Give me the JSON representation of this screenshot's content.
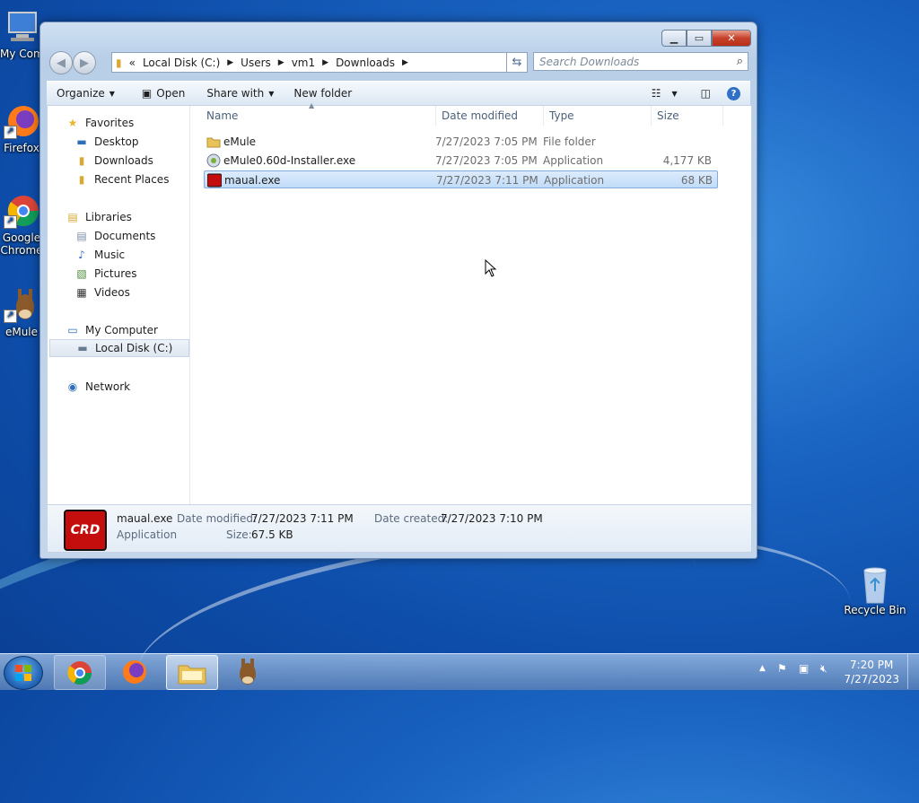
{
  "desktop": {
    "icons": [
      {
        "label": "My Computer"
      },
      {
        "label": "Firefox"
      },
      {
        "label": "Google Chrome"
      },
      {
        "label": "eMule"
      },
      {
        "label": "Recycle Bin"
      }
    ]
  },
  "window": {
    "address": {
      "overflow": "«",
      "crumbs": [
        "Local Disk (C:)",
        "Users",
        "vm1",
        "Downloads"
      ]
    },
    "search_placeholder": "Search Downloads",
    "toolbar": {
      "organize": "Organize",
      "open": "Open",
      "share_with": "Share with",
      "new_folder": "New folder"
    },
    "nav": {
      "favorites": "Favorites",
      "desktop": "Desktop",
      "downloads": "Downloads",
      "recent_places": "Recent Places",
      "libraries": "Libraries",
      "documents": "Documents",
      "music": "Music",
      "pictures": "Pictures",
      "videos": "Videos",
      "my_computer": "My Computer",
      "local_disk": "Local Disk (C:)",
      "network": "Network"
    },
    "columns": {
      "name": "Name",
      "date_modified": "Date modified",
      "type": "Type",
      "size": "Size"
    },
    "files": [
      {
        "name": "eMule",
        "date": "7/27/2023 7:05 PM",
        "type": "File folder",
        "size": ""
      },
      {
        "name": "eMule0.60d-Installer.exe",
        "date": "7/27/2023 7:05 PM",
        "type": "Application",
        "size": "4,177 KB"
      },
      {
        "name": "maual.exe",
        "date": "7/27/2023 7:11 PM",
        "type": "Application",
        "size": "68 KB"
      }
    ],
    "details": {
      "icon_text": "CRD",
      "name": "maual.exe",
      "type": "Application",
      "date_modified_label": "Date modified:",
      "date_modified": "7/27/2023 7:11 PM",
      "date_created_label": "Date created:",
      "date_created": "7/27/2023 7:10 PM",
      "size_label": "Size:",
      "size": "67.5 KB"
    }
  },
  "taskbar": {
    "clock_time": "7:20 PM",
    "clock_date": "7/27/2023"
  },
  "colors": {
    "selection": "#c1dcf8",
    "desktop_blue": "#1a64c2",
    "close_red": "#c7412a"
  }
}
